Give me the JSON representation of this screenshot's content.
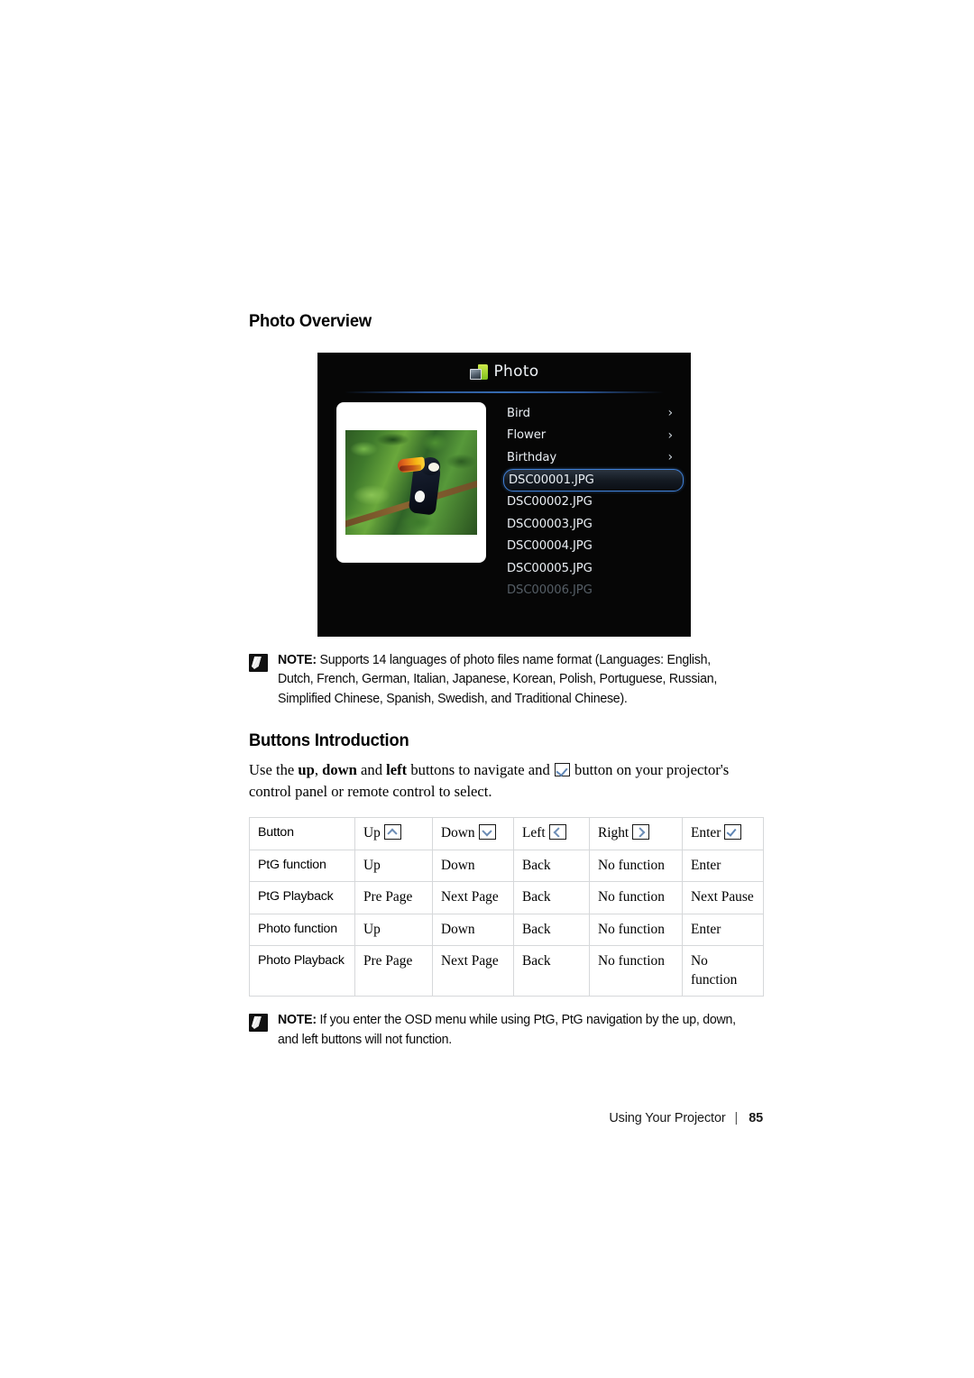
{
  "page": {
    "sections": {
      "photo_overview_title": "Photo Overview",
      "buttons_intro_title": "Buttons Introduction"
    }
  },
  "osd": {
    "title": "Photo",
    "icon": "photo-folder-icon",
    "preview_alt": "toucan-photo-thumbnail",
    "items": [
      {
        "label": "Bird",
        "chevron": "›",
        "state": "normal"
      },
      {
        "label": "Flower",
        "chevron": "›",
        "state": "normal"
      },
      {
        "label": "Birthday",
        "chevron": "›",
        "state": "normal"
      },
      {
        "label": "DSC00001.JPG",
        "chevron": "",
        "state": "selected"
      },
      {
        "label": "DSC00002.JPG",
        "chevron": "",
        "state": "normal"
      },
      {
        "label": "DSC00003.JPG",
        "chevron": "",
        "state": "normal"
      },
      {
        "label": "DSC00004.JPG",
        "chevron": "",
        "state": "normal"
      },
      {
        "label": "DSC00005.JPG",
        "chevron": "",
        "state": "normal"
      },
      {
        "label": "DSC00006.JPG",
        "chevron": "",
        "state": "dim"
      }
    ]
  },
  "note1": {
    "label": "NOTE:",
    "text": " Supports 14 languages of photo files name format (Languages: English, Dutch, French, German, Italian, Japanese, Korean, Polish, Portuguese, Russian, Simplified Chinese, Spanish, Swedish, and Traditional Chinese)."
  },
  "note2": {
    "label": "NOTE:",
    "text": " If you enter the OSD menu while using PtG, PtG navigation by the up, down, and left buttons will not function."
  },
  "intro": {
    "part1": "Use the ",
    "bold1": "up",
    "part2": ", ",
    "bold2": "down",
    "part3": " and ",
    "bold3": "left",
    "part4": " buttons to navigate and ",
    "part5": " button on your projector's control panel or remote control to select."
  },
  "table": {
    "headers": [
      {
        "label": "Button",
        "icon": ""
      },
      {
        "label": "Up",
        "icon": "up-arrow-key-icon"
      },
      {
        "label": "Down",
        "icon": "down-arrow-key-icon"
      },
      {
        "label": "Left",
        "icon": "left-arrow-key-icon"
      },
      {
        "label": "Right",
        "icon": "right-arrow-key-icon"
      },
      {
        "label": "Enter",
        "icon": "enter-check-key-icon"
      }
    ],
    "rows": [
      {
        "cells": [
          "PtG function",
          "Up",
          "Down",
          "Back",
          "No function",
          "Enter"
        ]
      },
      {
        "cells": [
          "PtG Playback",
          "Pre Page",
          "Next Page",
          "Back",
          "No function",
          "Next Pause"
        ]
      },
      {
        "cells": [
          "Photo function",
          "Up",
          "Down",
          "Back",
          "No function",
          "Enter"
        ]
      },
      {
        "cells": [
          "Photo Playback",
          "Pre Page",
          "Next Page",
          "Back",
          "No function",
          "No function"
        ]
      }
    ]
  },
  "footer": {
    "chapter": "Using Your Projector",
    "separator": "|",
    "page_number": "85"
  },
  "colors": {
    "accent_blue": "#3f7fd6",
    "key_glyph_blue": "#6b8cb5",
    "osd_background": "#060606",
    "table_border": "#d6d8da"
  }
}
